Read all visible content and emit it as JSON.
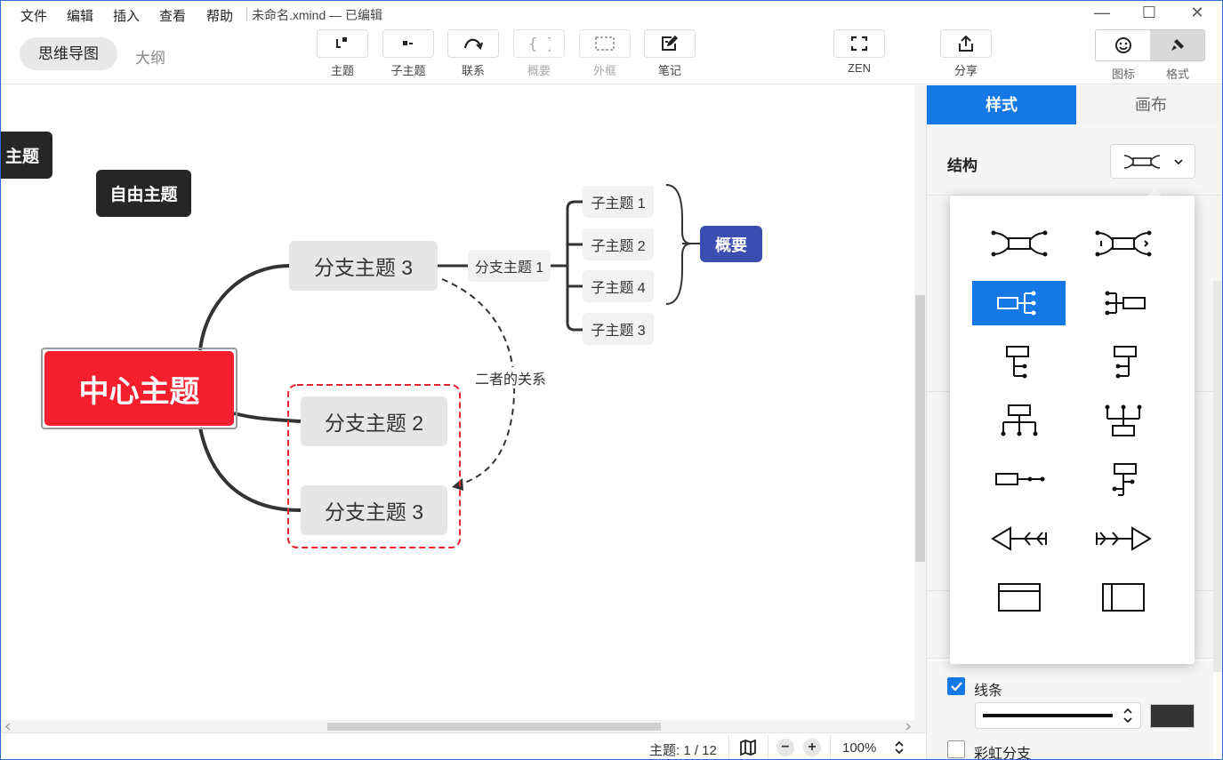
{
  "menu": {
    "items": [
      "文件",
      "编辑",
      "插入",
      "查看",
      "帮助"
    ],
    "doc_title": "未命名.xmind — 已编辑"
  },
  "window_controls": {
    "minimize": "—",
    "maximize": "☐",
    "close": "✕"
  },
  "toolbar": {
    "mode_mindmap": "思维导图",
    "mode_outline": "大纲",
    "tools": {
      "topic": "主题",
      "subtopic": "子主题",
      "relationship": "联系",
      "summary": "概要",
      "boundary": "外框",
      "note": "笔记",
      "zen": "ZEN",
      "share": "分享"
    },
    "icon_label": "图标",
    "format_label": "格式"
  },
  "canvas": {
    "floating_topic_partial": "主题",
    "floating_topic": "自由主题",
    "central_topic": "中心主题",
    "main_topics": [
      "分支主题 3",
      "分支主题 2",
      "分支主题 3"
    ],
    "subtopic_branch": "分支主题 1",
    "subtopics": [
      "子主题 1",
      "子主题 2",
      "子主题 4",
      "子主题 3"
    ],
    "summary": "概要",
    "relationship_label": "二者的关系"
  },
  "status": {
    "topic_count": "主题: 1 / 12",
    "zoom": "100%"
  },
  "panel": {
    "tabs": {
      "style": "样式",
      "canvas": "画布"
    },
    "structure_label": "结构",
    "line": {
      "label": "线条",
      "checked": true,
      "color": "#333333"
    },
    "rainbow": {
      "label": "彩虹分支",
      "checked": false
    }
  },
  "structure_options": {
    "selected": "logic-chart-right",
    "items": [
      "map-balanced",
      "map-clockwise",
      "logic-chart-right",
      "logic-chart-left",
      "tree-right",
      "tree-left",
      "org-chart-down",
      "org-chart-up",
      "timeline-horizontal",
      "timeline-vertical",
      "fishbone-left",
      "fishbone-right",
      "matrix-column",
      "matrix-row"
    ]
  },
  "colors": {
    "accent": "#1478e6",
    "central": "#f41f2e",
    "summary": "#3a4db0",
    "floating": "#262626",
    "boundary": "#e8242f"
  }
}
